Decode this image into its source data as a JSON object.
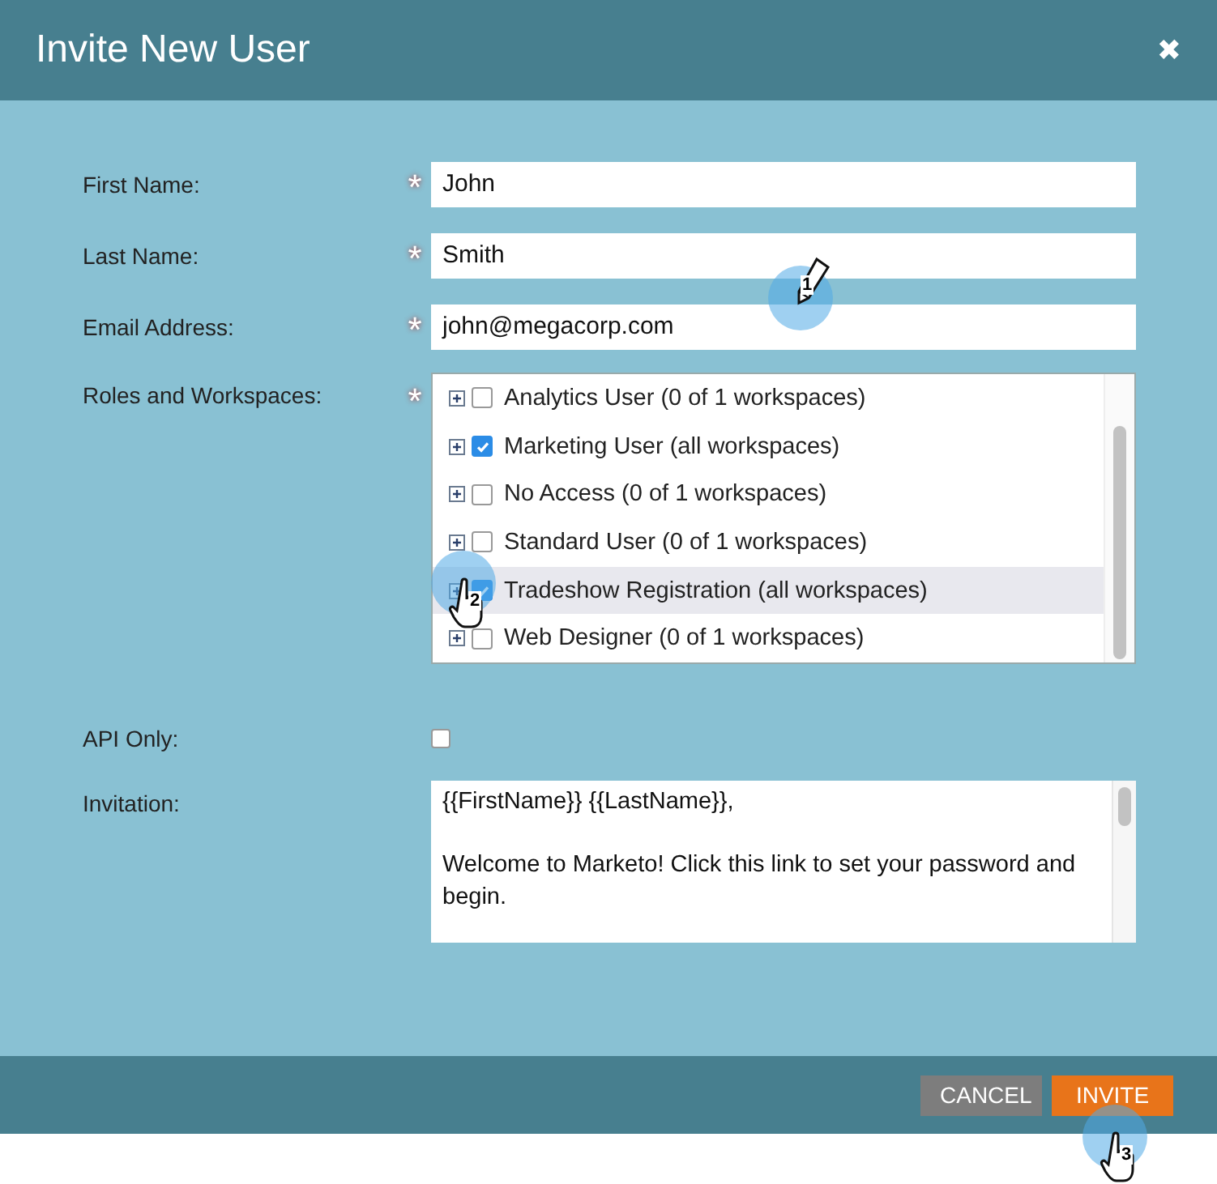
{
  "dialog": {
    "title": "Invite New User",
    "close": "✖"
  },
  "fields": [
    {
      "label": "First Name:",
      "marker": "*",
      "value": "John"
    },
    {
      "label": "Last Name:",
      "marker": "*",
      "value": "Smith"
    },
    {
      "label": "Email Address:",
      "marker": "*",
      "value": "john@megacorp.com"
    }
  ],
  "roles": {
    "label": "Roles and Workspaces:",
    "marker": "*",
    "items": [
      {
        "label": "Analytics User (0 of 1 workspaces)",
        "checked": false,
        "selected": false
      },
      {
        "label": "Marketing User (all workspaces)",
        "checked": true,
        "selected": false
      },
      {
        "label": "No Access (0 of 1 workspaces)",
        "checked": false,
        "selected": false
      },
      {
        "label": "Standard User (0 of 1 workspaces)",
        "checked": false,
        "selected": false
      },
      {
        "label": "Tradeshow Registration (all workspaces)",
        "checked": true,
        "selected": true
      },
      {
        "label": "Web Designer (0 of 1 workspaces)",
        "checked": false,
        "selected": false
      }
    ]
  },
  "api_only": {
    "label": "API Only:",
    "checked": false
  },
  "invitation": {
    "label": "Invitation:",
    "paragraphs": [
      "{{FirstName}} {{LastName}},",
      "Welcome to Marketo! Click this link to set your password and begin."
    ]
  },
  "buttons": [
    {
      "label": "CANCEL",
      "kind": "secondary"
    },
    {
      "label": "INVITE",
      "kind": "primary"
    }
  ],
  "callouts": [
    {
      "label": "1",
      "kind": "pencil"
    },
    {
      "label": "2",
      "kind": "hand"
    },
    {
      "label": "3",
      "kind": "hand"
    }
  ]
}
